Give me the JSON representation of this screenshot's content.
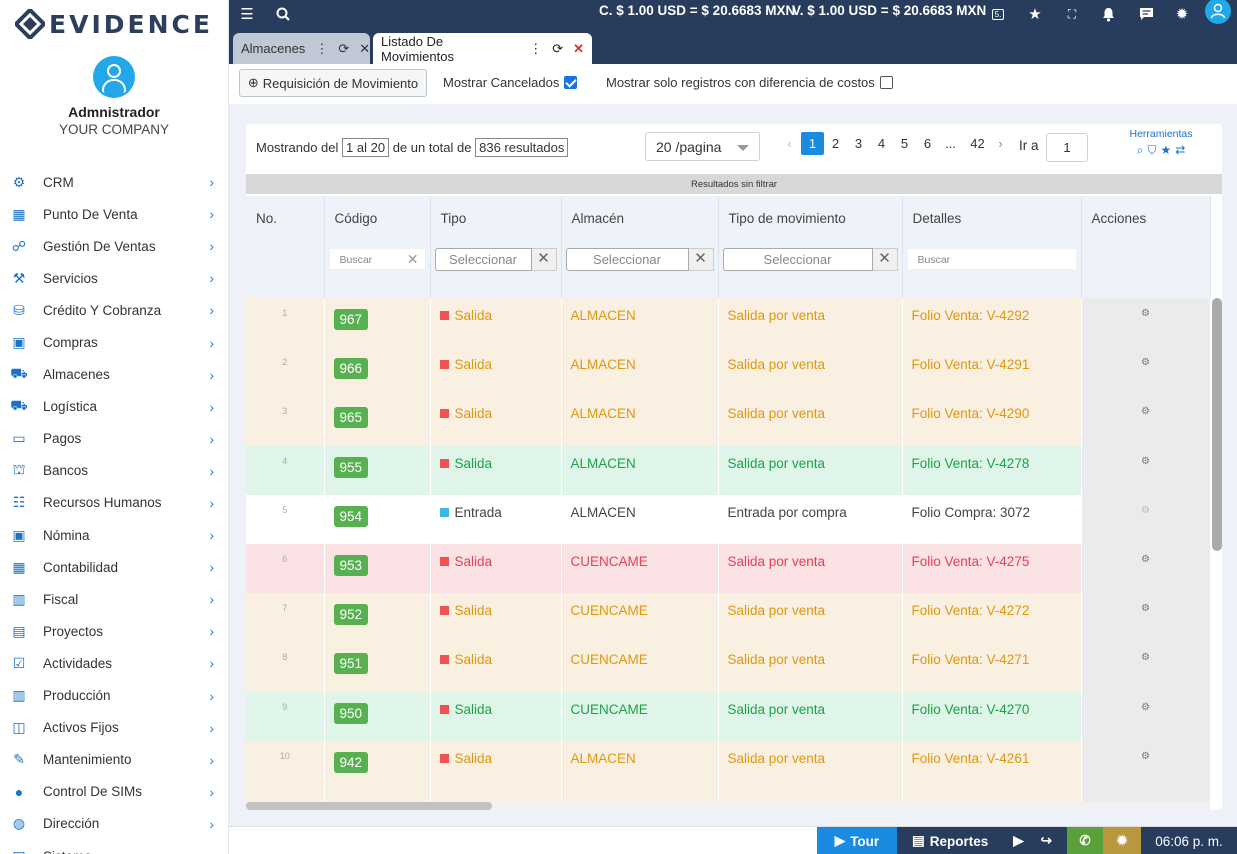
{
  "brand": {
    "name": "EVIDENCE"
  },
  "profile": {
    "name": "Admnistrador",
    "company": "YOUR COMPANY"
  },
  "sidebar": {
    "items": [
      {
        "label": "CRM",
        "icon": "crm-icon"
      },
      {
        "label": "Punto De Venta",
        "icon": "store-icon"
      },
      {
        "label": "Gestión De Ventas",
        "icon": "sales-icon"
      },
      {
        "label": "Servicios",
        "icon": "services-icon"
      },
      {
        "label": "Crédito Y Cobranza",
        "icon": "credit-icon"
      },
      {
        "label": "Compras",
        "icon": "purchases-icon"
      },
      {
        "label": "Almacenes",
        "icon": "warehouse-icon"
      },
      {
        "label": "Logística",
        "icon": "truck-icon"
      },
      {
        "label": "Pagos",
        "icon": "payments-icon"
      },
      {
        "label": "Bancos",
        "icon": "bank-icon"
      },
      {
        "label": "Recursos Humanos",
        "icon": "people-icon"
      },
      {
        "label": "Nómina",
        "icon": "payroll-icon"
      },
      {
        "label": "Contabilidad",
        "icon": "accounting-icon"
      },
      {
        "label": "Fiscal",
        "icon": "fiscal-icon"
      },
      {
        "label": "Proyectos",
        "icon": "projects-icon"
      },
      {
        "label": "Actividades",
        "icon": "checkbox-icon"
      },
      {
        "label": "Producción",
        "icon": "production-icon"
      },
      {
        "label": "Activos Fijos",
        "icon": "assets-icon"
      },
      {
        "label": "Mantenimiento",
        "icon": "wrench-icon"
      },
      {
        "label": "Control De SIMs",
        "icon": "location-icon"
      },
      {
        "label": "Dirección",
        "icon": "direction-icon"
      },
      {
        "label": "Sistema",
        "icon": "system-icon"
      }
    ]
  },
  "header": {
    "rate_c": "C. $ 1.00 USD = $ 20.6683 MXN",
    "rate_v": "V. $ 1.00 USD = $ 20.6683 MXN"
  },
  "tabs": [
    {
      "label": "Almacenes",
      "active": false
    },
    {
      "label": "Listado De Movimientos",
      "active": true
    }
  ],
  "actions": {
    "req_button": "Requisición de Movimiento",
    "show_cancelled": "Mostrar Cancelados",
    "show_diff": "Mostrar solo registros con diferencia de costos"
  },
  "pager": {
    "showing_prefix": "Mostrando del",
    "range": "1 al 20",
    "total_prefix": "de un total de",
    "total": "836 resultados",
    "per_page": "20 /pagina",
    "pages": [
      "1",
      "2",
      "3",
      "4",
      "5",
      "6",
      "...",
      "42"
    ],
    "current_page": "1",
    "goto_label": "Ir a",
    "goto_value": "1",
    "tools_label": "Herramientas"
  },
  "banner": "Resultados sin filtrar",
  "table": {
    "columns": [
      "No.",
      "Código",
      "Tipo",
      "Almacén",
      "Tipo de movimiento",
      "Detalles",
      "Acciones"
    ],
    "filters": {
      "search_placeholder": "Buscar",
      "select_placeholder": "Seleccionar"
    },
    "rows": [
      {
        "no": "1",
        "code": "967",
        "type": "Salida",
        "warehouse": "ALMACEN",
        "movement": "Salida por venta",
        "details": "Folio Venta: V-4292",
        "tone": "orange",
        "type_color": "#f0524f"
      },
      {
        "no": "2",
        "code": "966",
        "type": "Salida",
        "warehouse": "ALMACEN",
        "movement": "Salida por venta",
        "details": "Folio Venta: V-4291",
        "tone": "orange",
        "type_color": "#f0524f"
      },
      {
        "no": "3",
        "code": "965",
        "type": "Salida",
        "warehouse": "ALMACEN",
        "movement": "Salida por venta",
        "details": "Folio Venta: V-4290",
        "tone": "orange",
        "type_color": "#f0524f"
      },
      {
        "no": "4",
        "code": "955",
        "type": "Salida",
        "warehouse": "ALMACEN",
        "movement": "Salida por venta",
        "details": "Folio Venta: V-4278",
        "tone": "green",
        "type_color": "#f0524f"
      },
      {
        "no": "5",
        "code": "954",
        "type": "Entrada",
        "warehouse": "ALMACEN",
        "movement": "Entrada por compra",
        "details": "Folio Compra: 3072",
        "tone": "white",
        "type_color": "#3fb6ea"
      },
      {
        "no": "6",
        "code": "953",
        "type": "Salida",
        "warehouse": "CUENCAME",
        "movement": "Salida por venta",
        "details": "Folio Venta: V-4275",
        "tone": "red",
        "type_color": "#f0524f"
      },
      {
        "no": "7",
        "code": "952",
        "type": "Salida",
        "warehouse": "CUENCAME",
        "movement": "Salida por venta",
        "details": "Folio Venta: V-4272",
        "tone": "orange",
        "type_color": "#f0524f"
      },
      {
        "no": "8",
        "code": "951",
        "type": "Salida",
        "warehouse": "CUENCAME",
        "movement": "Salida por venta",
        "details": "Folio Venta: V-4271",
        "tone": "orange",
        "type_color": "#f0524f"
      },
      {
        "no": "9",
        "code": "950",
        "type": "Salida",
        "warehouse": "CUENCAME",
        "movement": "Salida por venta",
        "details": "Folio Venta: V-4270",
        "tone": "green",
        "type_color": "#f0524f"
      },
      {
        "no": "10",
        "code": "942",
        "type": "Salida",
        "warehouse": "ALMACEN",
        "movement": "Salida por venta",
        "details": "Folio Venta: V-4261",
        "tone": "orange",
        "type_color": "#f0524f"
      }
    ]
  },
  "footer": {
    "tour": "Tour",
    "reports": "Reportes",
    "time": "06:06 p. m.",
    "colors": {
      "tour": "#1a8be0",
      "reports": "#283c5e",
      "whatsapp": "#5aa13c",
      "settings": "#b8973f",
      "clock": "#283c5e"
    }
  }
}
